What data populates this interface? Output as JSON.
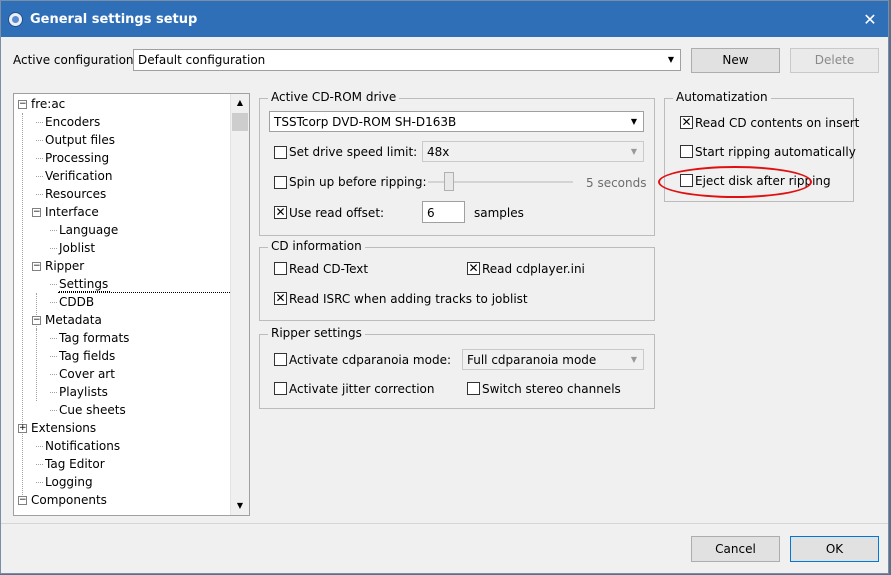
{
  "window": {
    "title": "General settings setup",
    "close_glyph": "✕"
  },
  "config": {
    "label": "Active configuration:",
    "value": "Default configuration",
    "new_label": "New",
    "delete_label": "Delete"
  },
  "tree": {
    "items": [
      {
        "label": "fre:ac",
        "expander": "−"
      },
      {
        "label": "Encoders"
      },
      {
        "label": "Output files"
      },
      {
        "label": "Processing"
      },
      {
        "label": "Verification"
      },
      {
        "label": "Resources"
      },
      {
        "label": "Interface",
        "expander": "−"
      },
      {
        "label": "Language"
      },
      {
        "label": "Joblist"
      },
      {
        "label": "Ripper",
        "expander": "−"
      },
      {
        "label": "Settings",
        "selected": true
      },
      {
        "label": "CDDB"
      },
      {
        "label": "Metadata",
        "expander": "−"
      },
      {
        "label": "Tag formats"
      },
      {
        "label": "Tag fields"
      },
      {
        "label": "Cover art"
      },
      {
        "label": "Playlists"
      },
      {
        "label": "Cue sheets"
      },
      {
        "label": "Extensions",
        "expander": "+"
      },
      {
        "label": "Notifications"
      },
      {
        "label": "Tag Editor"
      },
      {
        "label": "Logging"
      },
      {
        "label": "Components",
        "expander": "−"
      }
    ],
    "scroll_up": "▲",
    "scroll_down": "▼"
  },
  "drive_group": {
    "title": "Active CD-ROM drive",
    "drive": "TSSTcorp DVD-ROM SH-D163B",
    "speed_label": "Set drive speed limit:",
    "speed_checked": false,
    "speed_value": "48x",
    "spinup_label": "Spin up before ripping:",
    "spinup_checked": false,
    "spinup_value": "5 seconds",
    "offset_label": "Use read offset:",
    "offset_checked": true,
    "offset_value": "6",
    "offset_unit": "samples"
  },
  "cdinfo_group": {
    "title": "CD information",
    "cdtext_label": "Read CD-Text",
    "cdtext_checked": false,
    "cdplayer_label": "Read cdplayer.ini",
    "cdplayer_checked": true,
    "isrc_label": "Read ISRC when adding tracks to joblist",
    "isrc_checked": true
  },
  "ripper_group": {
    "title": "Ripper settings",
    "paranoia_label": "Activate cdparanoia mode:",
    "paranoia_checked": false,
    "paranoia_value": "Full cdparanoia mode",
    "jitter_label": "Activate jitter correction",
    "jitter_checked": false,
    "stereo_label": "Switch stereo channels",
    "stereo_checked": false
  },
  "auto_group": {
    "title": "Automatization",
    "read_label": "Read CD contents on insert",
    "read_checked": true,
    "start_label": "Start ripping automatically",
    "start_checked": false,
    "eject_label": "Eject disk after ripping",
    "eject_checked": false
  },
  "footer": {
    "cancel_label": "Cancel",
    "ok_label": "OK"
  },
  "glyphs": {
    "check": "✕",
    "dropdown": "▼"
  },
  "colors": {
    "titlebar": "#2f6fb8",
    "annotation": "#e01010"
  }
}
